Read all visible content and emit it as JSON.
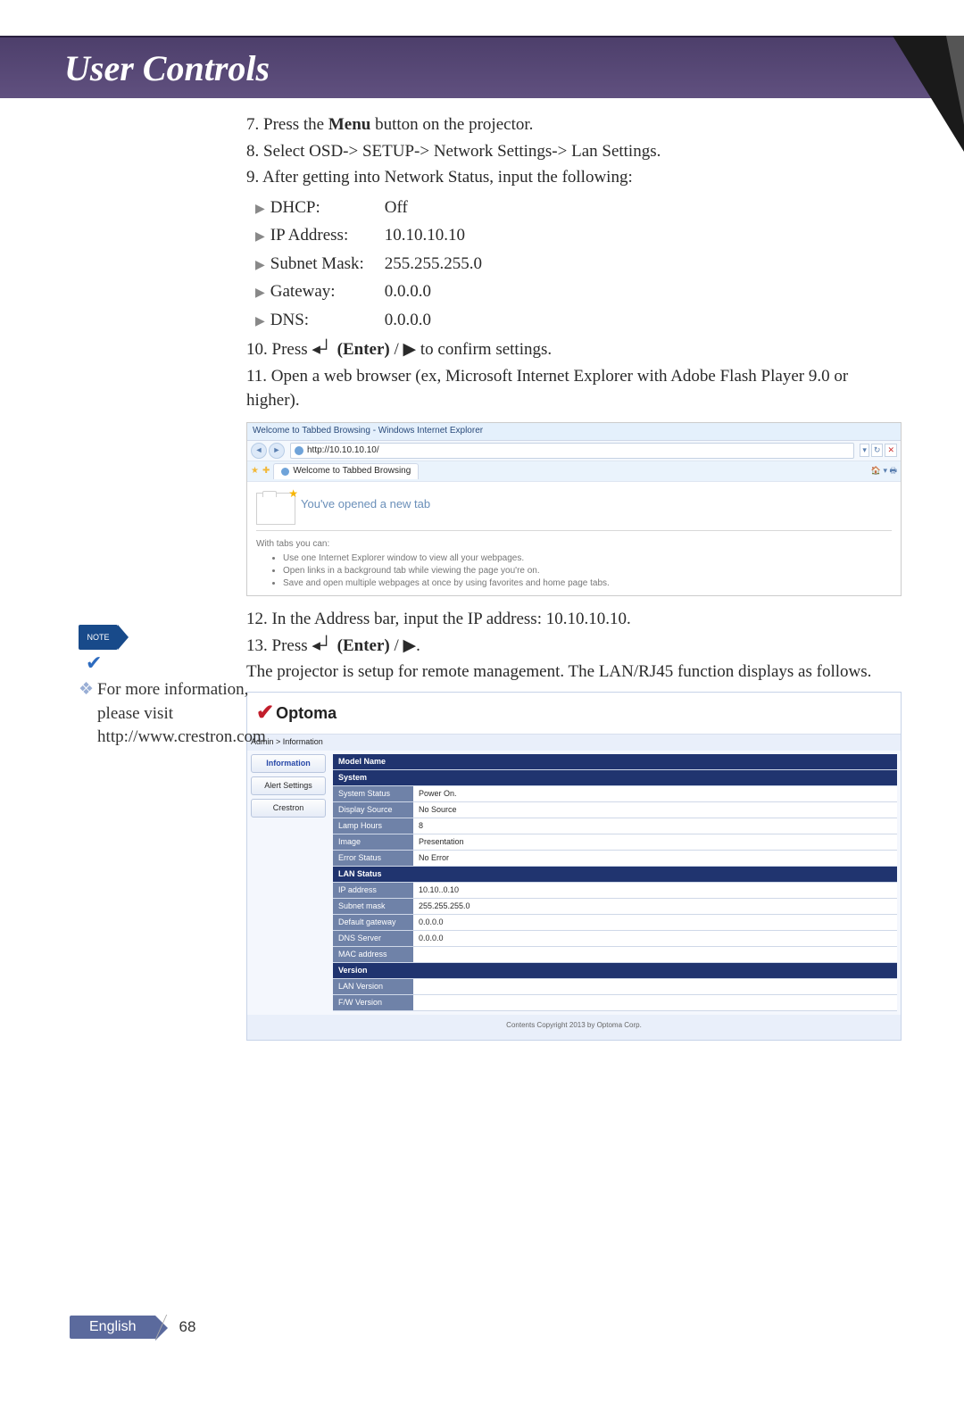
{
  "header": {
    "title": "User Controls"
  },
  "steps": {
    "s7a": "7. Press the ",
    "s7b": "Menu",
    "s7c": " button on the projector.",
    "s8": "8. Select OSD-> SETUP-> Network Settings-> Lan Settings.",
    "s9": "9. After getting into Network Status, input the following:",
    "s10a": "10. Press ",
    "s10b": "(Enter)",
    "s10c": " / ▶ to confirm settings.",
    "s11": "11. Open a web browser (ex, Microsoft Internet Explorer with Adobe Flash Player 9.0 or higher).",
    "s12": "12. In the Address bar, input the IP address: 10.10.10.10.",
    "s13a": "13. Press ",
    "s13b": "(Enter)",
    "s13c": " / ▶.",
    "s14": "The projector is setup for remote management. The LAN/RJ45 function displays as follows."
  },
  "settings": [
    {
      "k": "DHCP:",
      "v": "Off"
    },
    {
      "k": "IP Address:",
      "v": "10.10.10.10"
    },
    {
      "k": "Subnet Mask:",
      "v": "255.255.255.0"
    },
    {
      "k": "Gateway:",
      "v": "0.0.0.0"
    },
    {
      "k": "DNS:",
      "v": "0.0.0.0"
    }
  ],
  "ie": {
    "title": "Welcome to Tabbed Browsing - Windows Internet Explorer",
    "url": "http://10.10.10.10/",
    "tab": "Welcome to Tabbed Browsing",
    "newtab": "You've opened a new tab",
    "intro": "With tabs you can:",
    "b1": "Use one Internet Explorer window to view all your webpages.",
    "b2": "Open links in a background tab while viewing the page you're on.",
    "b3": "Save and open multiple webpages at once by using favorites and home page tabs."
  },
  "note": {
    "label": "NOTE",
    "text": "For more information, please visit http://www.crestron.com"
  },
  "opt": {
    "logo": "Optoma",
    "breadcrumb": "Admin > Information",
    "side": {
      "info": "Information",
      "alert": "Alert Settings",
      "crestron": "Crestron"
    },
    "headers": {
      "model": "Model Name",
      "system": "System",
      "lan": "LAN Status",
      "ver": "Version"
    },
    "rows": {
      "sysstatus_k": "System Status",
      "sysstatus_v": "Power On.",
      "dispsrc_k": "Display Source",
      "dispsrc_v": "No Source",
      "lamp_k": "Lamp Hours",
      "lamp_v": "8",
      "image_k": "Image",
      "image_v": "Presentation",
      "err_k": "Error Status",
      "err_v": "No Error",
      "ip_k": "IP address",
      "ip_v": "10.10..0.10",
      "subnet_k": "Subnet mask",
      "subnet_v": "255.255.255.0",
      "gw_k": "Default gateway",
      "gw_v": "0.0.0.0",
      "dns_k": "DNS Server",
      "dns_v": "0.0.0.0",
      "mac_k": "MAC address",
      "mac_v": "",
      "lanv_k": "LAN Version",
      "lanv_v": "",
      "fwv_k": "F/W Version",
      "fwv_v": ""
    },
    "footer": "Contents Copyright 2013 by Optoma Corp."
  },
  "pagefoot": {
    "lang": "English",
    "page": "68"
  }
}
